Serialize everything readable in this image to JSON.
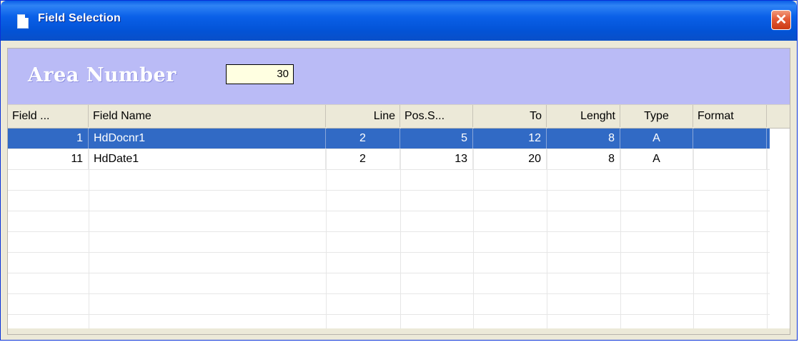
{
  "window": {
    "title": "Field Selection",
    "close_glyph": "✕"
  },
  "area": {
    "label": "Area Number",
    "value": "30"
  },
  "table": {
    "columns": [
      "Field ...",
      "Field Name",
      "Line",
      "Pos.S...",
      "To",
      "Lenght",
      "Type",
      "Format"
    ],
    "rows": [
      {
        "field": "1",
        "name": "HdDocnr1",
        "line": "2",
        "pos": "5",
        "to": "12",
        "length": "8",
        "type": "A",
        "format": "",
        "selected": true
      },
      {
        "field": "11",
        "name": "HdDate1",
        "line": "2",
        "pos": "13",
        "to": "20",
        "length": "8",
        "type": "A",
        "format": "",
        "selected": false
      }
    ]
  },
  "colors": {
    "titlebar": "#0a5fe6",
    "panel": "#babbf6",
    "selection": "#316ac5",
    "input_bg": "#ffffe1",
    "close": "#e35a36"
  },
  "icons": {
    "title": "document-icon",
    "close": "close-icon"
  }
}
